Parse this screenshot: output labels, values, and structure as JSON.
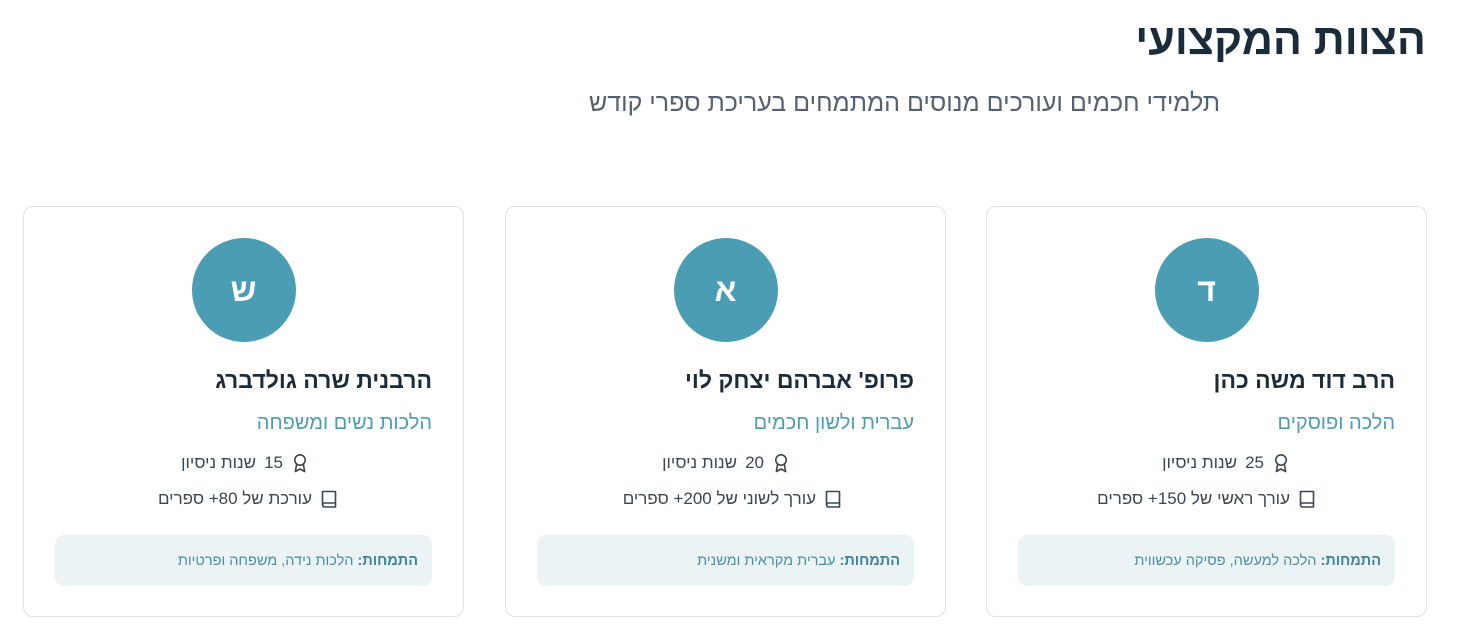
{
  "header": {
    "title": "הצוות המקצועי",
    "subtitle": "תלמידי חכמים ועורכים מנוסים המתמחים בעריכת ספרי קודש"
  },
  "colors": {
    "accent": "#4b9db3",
    "spec_background": "#ebf3f5",
    "heading": "#1a2b39"
  },
  "team": [
    {
      "initial": "ד",
      "name": "הרב דוד משה כהן",
      "role": "הלכה ופוסקים",
      "experience_years": "25",
      "experience_label": "שנות ניסיון",
      "books": "עורך ראשי של 150+ ספרים",
      "spec_label": "התמחות:",
      "spec_value": "הלכה למעשה, פסיקה עכשווית"
    },
    {
      "initial": "א",
      "name": "פרופ' אברהם יצחק לוי",
      "role": "עברית ולשון חכמים",
      "experience_years": "20",
      "experience_label": "שנות ניסיון",
      "books": "עורך לשוני של 200+ ספרים",
      "spec_label": "התמחות:",
      "spec_value": "עברית מקראית ומשנית"
    },
    {
      "initial": "ש",
      "name": "הרבנית שרה גולדברג",
      "role": "הלכות נשים ומשפחה",
      "experience_years": "15",
      "experience_label": "שנות ניסיון",
      "books": "עורכת של 80+ ספרים",
      "spec_label": "התמחות:",
      "spec_value": "הלכות נידה, משפחה ופרטיות"
    }
  ]
}
